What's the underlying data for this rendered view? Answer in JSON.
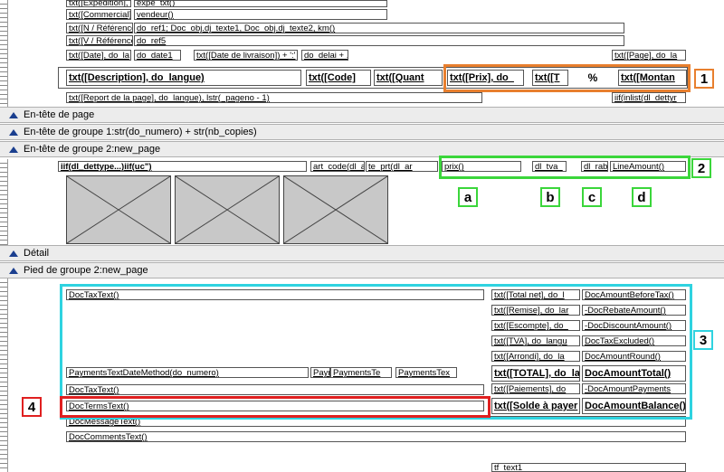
{
  "header_fields": [
    "txt([Expedition],",
    "expe_txt()",
    "txt([Commercial]",
    "vendeur()",
    "txt([N / Référence",
    "do_ref1; Doc_obj.dj_texte1, Doc_obj.dj_texte2, km()",
    "txt([V / Référence",
    "do_ref5",
    "txt([Date], do_la",
    "do_date1",
    "txt([Date de livraison]) + ':'",
    "do_delai + ...",
    "txt([Page], do_la"
  ],
  "column_headers": {
    "description": "txt([Description], do_langue)",
    "code": "txt([Code]",
    "quantity": "txt([Quant",
    "price": "txt([Prix], do_",
    "t": "txt([T",
    "percent": "%",
    "amount": "txt([Montan"
  },
  "report_page": "txt([Report de la page], do_langue), lstr(_pageno - 1)",
  "iif_field": "iif(inlist(dl_dettyr",
  "bands": {
    "page_header": "En-tête de page",
    "group1_header": "En-tête de groupe 1:str(do_numero) + str(nb_copies)",
    "group2_header": "En-tête de groupe 2:new_page",
    "detail": "Détail",
    "group2_footer": "Pied de groupe 2:new_page"
  },
  "detail_fields": {
    "overlap": "iif(dl_dettype...)iif(uc\")",
    "art_code": "art_code(dl_ar",
    "prt": "te_prt(dl_ar",
    "prix": "prix()",
    "tva": "dl_tva_",
    "rab": "dl_rab_",
    "line_amount": "LineAmount()"
  },
  "callouts": [
    "1",
    "2",
    "3",
    "4"
  ],
  "letters": [
    "a",
    "b",
    "c",
    "d"
  ],
  "footer": {
    "doc_tax_text": "DocTaxText()",
    "payments_method": "PaymentsTextDateMethod(do_numero)",
    "pay1": "Paym",
    "pay2": "PaymentsTe",
    "pay3": "PaymentsTex",
    "doc_tax_text2": "DocTaxText()",
    "terms": "DocTermsText()",
    "message": "DocMessageText()",
    "comments": "DocCommentsText()",
    "totals_labels": [
      "txt([Total net], do_l",
      "txt([Remise], do_lar",
      "txt([Escompte], do_",
      "txt([TVA], do_langu",
      "txt([Arrondi], do_la",
      "txt([TOTAL], do_la",
      "txt([Paiements], do",
      "txt([Solde à payer"
    ],
    "totals_values": [
      "DocAmountBeforeTax()",
      "-DocRebateAmount()",
      "-DocDiscountAmount()",
      "DocTaxExcluded()",
      "DocAmountRound()",
      "DocAmountTotal()",
      "-DocAmountPayments",
      "DocAmountBalance()"
    ],
    "tf_text": "tf_text1"
  }
}
